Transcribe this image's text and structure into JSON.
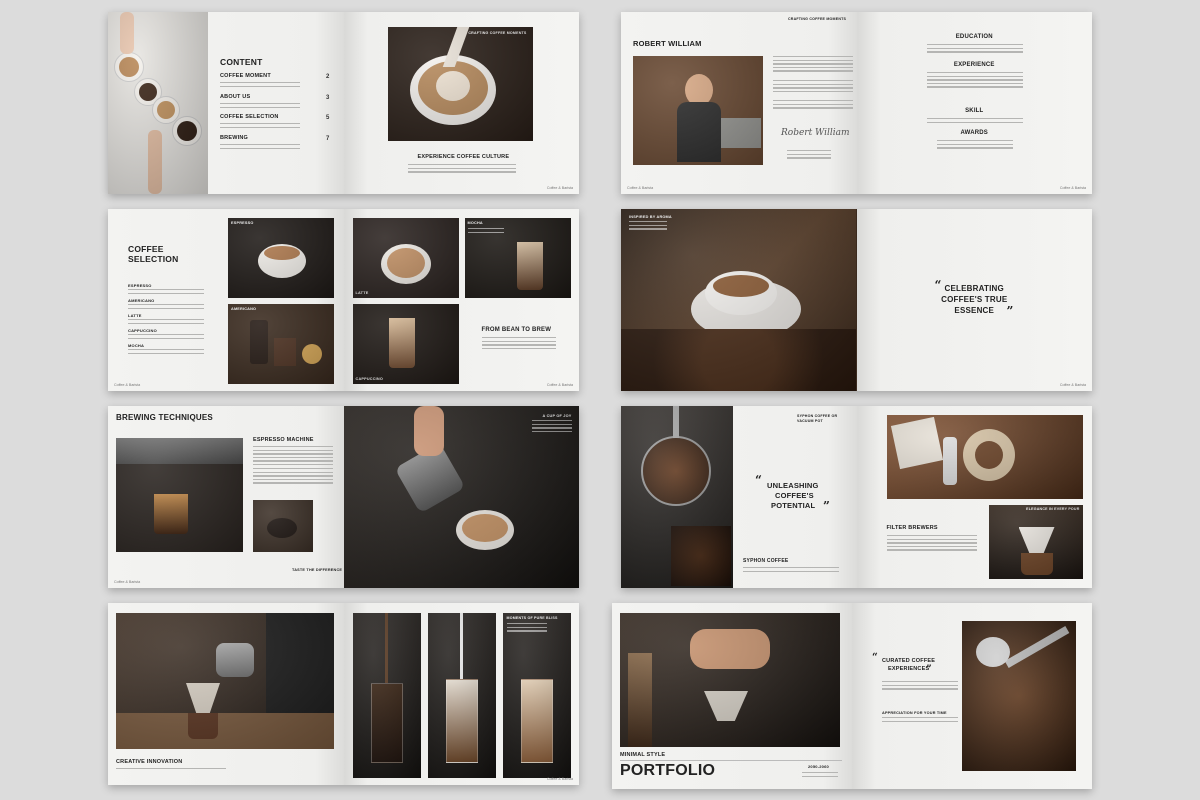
{
  "brand": "Coffee & Barista",
  "spread1": {
    "title": "CONTENT",
    "toc": [
      {
        "label": "COFFEE MOMENT",
        "page": "2"
      },
      {
        "label": "ABOUT US",
        "page": "3"
      },
      {
        "label": "COFFEE SELECTION",
        "page": "5"
      },
      {
        "label": "BREWING",
        "page": "7"
      }
    ],
    "photo_label": "CRAFTING COFFEE MOMENTS",
    "caption": "EXPERIENCE COFFEE CULTURE",
    "page_left": "",
    "page_right": "2"
  },
  "spread2": {
    "label": "CRAFTING COFFEE MOMENTS",
    "name": "ROBERT WILLIAM",
    "signature": "Robert William",
    "sections": [
      "EDUCATION",
      "EXPERIENCE",
      "SKILL",
      "AWARDS"
    ],
    "page_left": "3",
    "page_right": "4"
  },
  "spread3": {
    "title_line1": "COFFEE",
    "title_line2": "SELECTION",
    "items": [
      "ESPRESSO",
      "AMERICANO",
      "LATTE",
      "CAPPUCCINO",
      "MOCHA"
    ],
    "photo_labels": [
      "ESPRESSO",
      "AMERICANO",
      "LATTE",
      "MOCHA",
      "CAPPUCCINO"
    ],
    "caption": "FROM BEAN TO BREW",
    "page_left": "5",
    "page_right": "6"
  },
  "spread4": {
    "label": "INSPIRED BY AROMA",
    "quote_open": "“",
    "quote_line1": "CELEBRATING",
    "quote_line2": "COFFEE'S TRUE",
    "quote_line3": "ESSENCE",
    "quote_close": "”",
    "page_right": "7"
  },
  "spread5": {
    "title": "BREWING TECHNIQUES",
    "subtitle": "ESPRESSO MACHINE",
    "caption": "TASTE THE DIFFERENCE",
    "photo_label": "A CUP OF JOY",
    "page_left": "9"
  },
  "spread6": {
    "label": "SYPHON COFFEE OR VACUUM POT",
    "quote_open": "“",
    "quote_line1": "UNLEASHING",
    "quote_line2": "COFFEE'S",
    "quote_line3": "POTENTIAL",
    "quote_close": "”",
    "caption": "SYPHON COFFEE",
    "photo_label": "ELEGANCE IN EVERY POUR",
    "filter_title": "FILTER BREWERS"
  },
  "spread7": {
    "caption": "CREATIVE INNOVATION",
    "photo_label": "MOMENTS OF PURE BLISS",
    "page_right": "10"
  },
  "spread8": {
    "minimal": "MINIMAL STYLE",
    "portfolio": "PORTFOLIO",
    "years": "2050-2060",
    "quote_open": "“",
    "quote_line1": "CURATED COFFEE",
    "quote_line2": "EXPERIENCES",
    "quote_close": "”",
    "contact_title": "APPRECIATION FOR YOUR TIME"
  }
}
